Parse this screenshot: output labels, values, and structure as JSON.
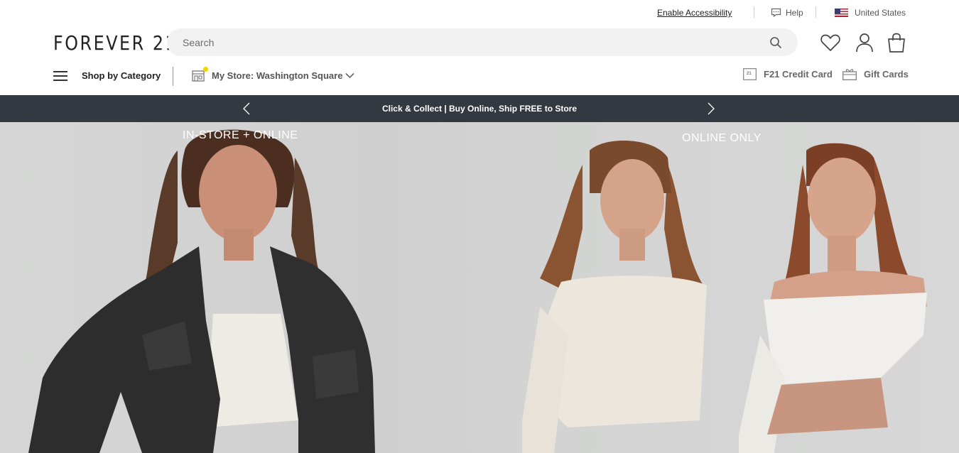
{
  "utility": {
    "accessibility": "Enable Accessibility",
    "help": "Help",
    "country": "United States"
  },
  "header": {
    "logo": "FOREVER 21",
    "search_placeholder": "Search"
  },
  "nav": {
    "shop_by_category": "Shop by Category",
    "my_store": "My Store: Washington Square",
    "credit_card": "F21 Credit Card",
    "gift_cards": "Gift Cards"
  },
  "promo": {
    "text": "Click & Collect | Buy Online, Ship FREE to Store"
  },
  "hero": {
    "left_label": "IN-STORE + ONLINE",
    "right_label": "ONLINE ONLY"
  },
  "colors": {
    "promo_bg": "#333940",
    "store_dot": "#f1d400"
  }
}
